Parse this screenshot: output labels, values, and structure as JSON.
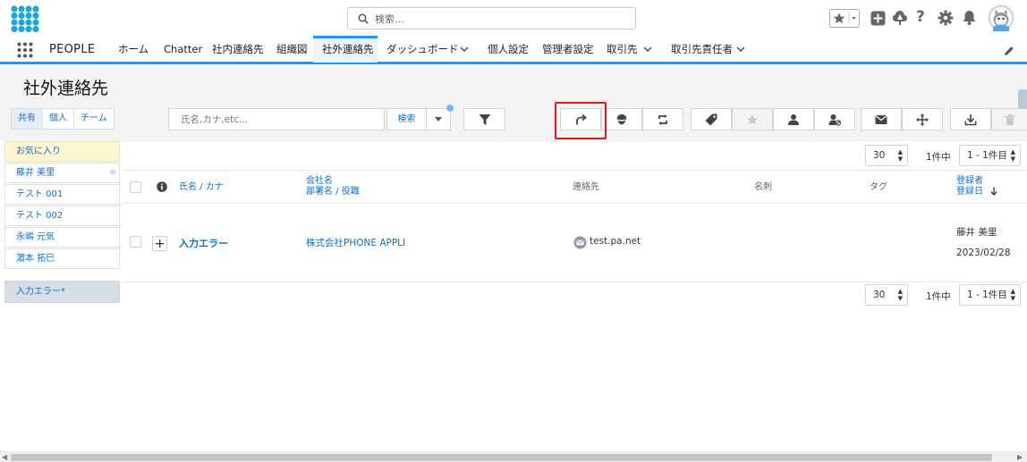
{
  "header": {
    "search_placeholder": "検索...",
    "icons": [
      "waffle-logo",
      "star-icon",
      "plus-icon",
      "trailhead-icon",
      "help-icon",
      "gear-icon",
      "bell-icon",
      "avatar"
    ]
  },
  "nav": {
    "app_name": "PEOPLE",
    "tabs": [
      {
        "label": "ホーム"
      },
      {
        "label": "Chatter"
      },
      {
        "label": "社内連絡先"
      },
      {
        "label": "組織図"
      },
      {
        "label": "社外連絡先",
        "active": true
      },
      {
        "label": "ダッシュボード",
        "dropdown": true
      },
      {
        "label": "個人設定"
      },
      {
        "label": "管理者設定"
      },
      {
        "label": "取引先",
        "dropdown": true
      },
      {
        "label": "取引先責任者",
        "dropdown": true
      }
    ]
  },
  "page": {
    "title": "社外連絡先",
    "scope_tabs": [
      "共有",
      "個人",
      "チーム"
    ],
    "name_placeholder": "氏名,カナ,etc...",
    "search_label": "検索"
  },
  "left_list": {
    "favorites_label": "お気に入り",
    "items": [
      "藤井 美里",
      "テスト 001",
      "テスト 002",
      "永嶋 元気",
      "濵本 拓巳"
    ],
    "error_filter": "入力エラー*"
  },
  "pager": {
    "per_page": "30",
    "count_text": "1件中",
    "range": "1 - 1件目"
  },
  "table": {
    "headers": {
      "name": "氏名 / カナ",
      "company_1": "会社名",
      "company_2": "部署名 / 役職",
      "contact": "連絡先",
      "card": "名刺",
      "tag": "タグ",
      "registrant_1": "登録者",
      "registrant_2": "登録日"
    },
    "rows": [
      {
        "name": "入力エラー",
        "company": "株式会社PHONE APPLI",
        "email": "test.pa.net",
        "registrant": "藤井 美里",
        "date": "2023/02/28"
      }
    ]
  },
  "colors": {
    "accent": "#1b96ff",
    "link": "#0b6fd0",
    "highlight": "#e4151d",
    "logo": "#1da6d9"
  }
}
